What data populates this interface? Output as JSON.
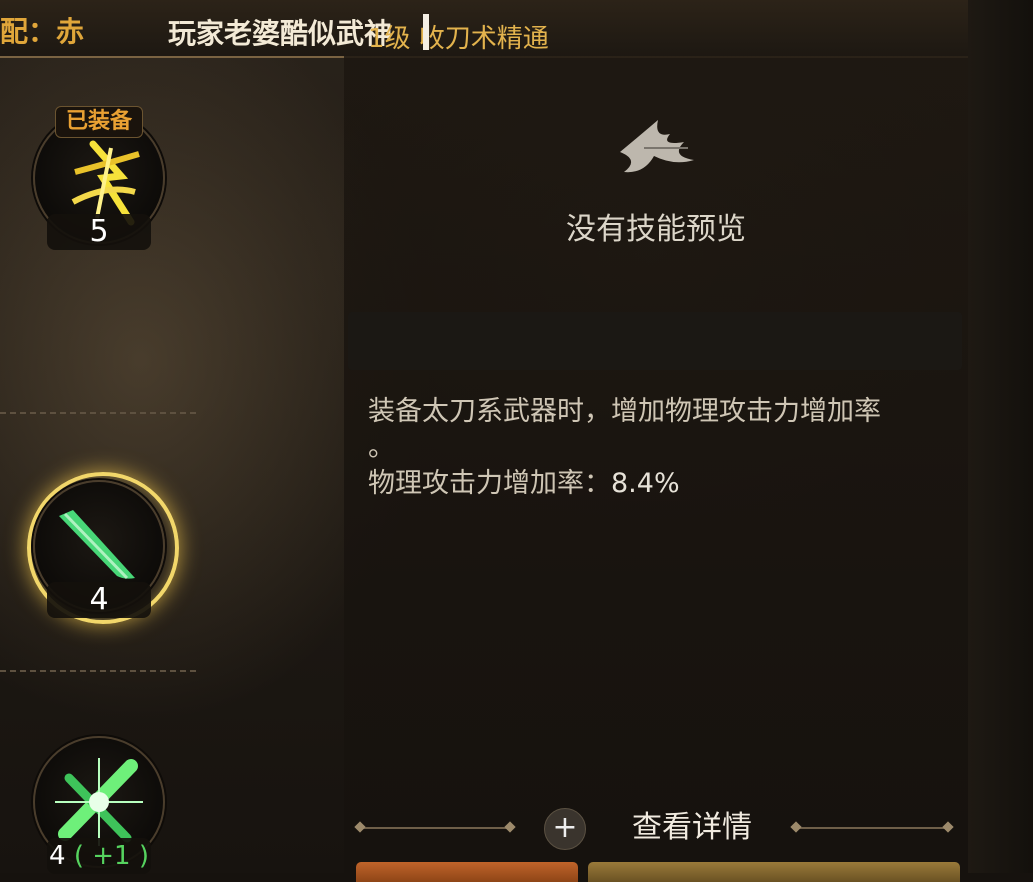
{
  "header": {
    "match_label": "配：赤",
    "player_name": "玩家老婆酷似武神",
    "skill_title": "1级 收刀术精通"
  },
  "skills": [
    {
      "badge": "已装备",
      "level": "5",
      "icon": "lightning-slash-icon"
    },
    {
      "level": "4",
      "icon": "katana-blade-icon",
      "selected": true
    },
    {
      "level": "4",
      "bonus": "( +1 )",
      "icon": "cross-slash-icon"
    }
  ],
  "preview": {
    "icon": "no-preview-emblem-icon",
    "text": "没有技能预览"
  },
  "description": {
    "line1": "装备太刀系武器时，增加物理攻击力增加率",
    "line2": "。",
    "stat_label": "物理攻击力增加率：",
    "stat_value": "8.4%"
  },
  "detail": {
    "label": "查看详情",
    "plus": "+"
  },
  "colors": {
    "accent_gold": "#e3b34d",
    "bonus_green": "#56d35f",
    "selection_glow": "#f2d76a"
  }
}
